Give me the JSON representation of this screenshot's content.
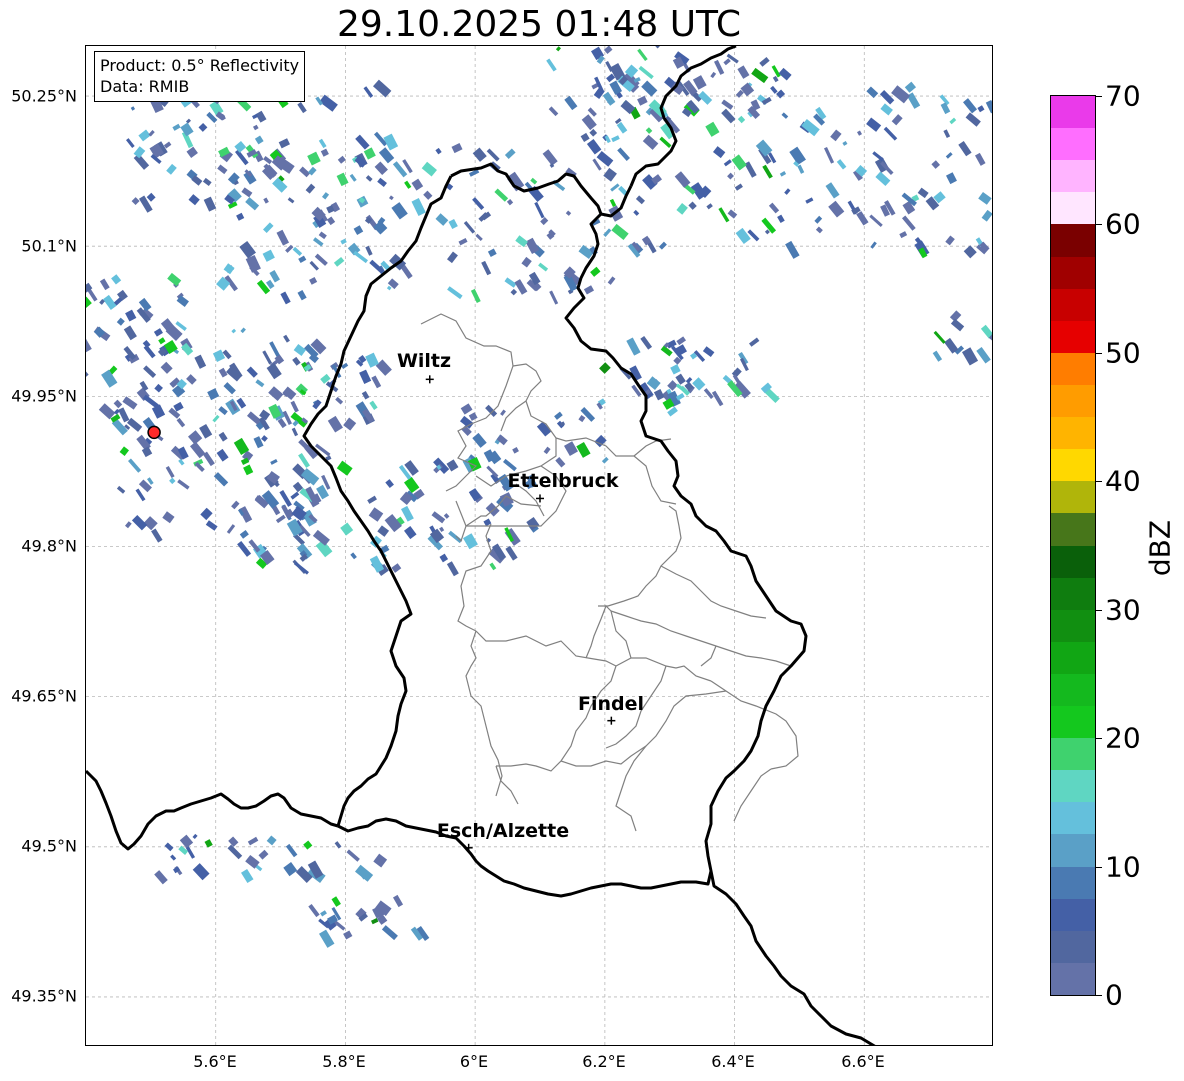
{
  "title": "29.10.2025 01:48 UTC",
  "info_box": {
    "product_line": "Product: 0.5° Reflectivity",
    "data_line": "Data: RMIB"
  },
  "map": {
    "lat_ticks": [
      "50.25°N",
      "50.1°N",
      "49.95°N",
      "49.8°N",
      "49.65°N",
      "49.5°N",
      "49.35°N"
    ],
    "lon_ticks": [
      "5.6°E",
      "5.8°E",
      "6°E",
      "6.2°E",
      "6.4°E",
      "6.6°E"
    ],
    "lat_range": [
      49.3,
      50.3
    ],
    "lon_range": [
      5.4,
      6.8
    ],
    "gridlines": true,
    "cities": [
      {
        "name": "Wiltz",
        "lon": 5.93,
        "lat": 49.967
      },
      {
        "name": "Ettelbruck",
        "lon": 6.1,
        "lat": 49.848
      },
      {
        "name": "Findel",
        "lon": 6.21,
        "lat": 49.626
      },
      {
        "name": "Esch/Alzette",
        "lon": 5.99,
        "lat": 49.499
      }
    ],
    "radar_site": {
      "lon": 5.505,
      "lat": 49.914
    },
    "border_color": "#000000",
    "canton_color": "#808080"
  },
  "colorbar": {
    "label": "dBZ",
    "range": [
      0,
      70
    ],
    "tick_labels": [
      "0",
      "10",
      "20",
      "30",
      "40",
      "50",
      "60",
      "70"
    ],
    "colors": [
      "#6472a8",
      "#51679f",
      "#4460a6",
      "#4a7ab2",
      "#5aa0c7",
      "#64c0dc",
      "#5fd6c2",
      "#3fd26e",
      "#14c81e",
      "#14b91e",
      "#11a614",
      "#118f11",
      "#0f7d0f",
      "#0a600a",
      "#47761a",
      "#b0b50a",
      "#ffd800",
      "#ffb400",
      "#ff9c00",
      "#ff7d00",
      "#e60000",
      "#c80000",
      "#a00000",
      "#7a0000",
      "#ffe6ff",
      "#ffb4ff",
      "#ff6eff",
      "#ea3aea"
    ]
  }
}
